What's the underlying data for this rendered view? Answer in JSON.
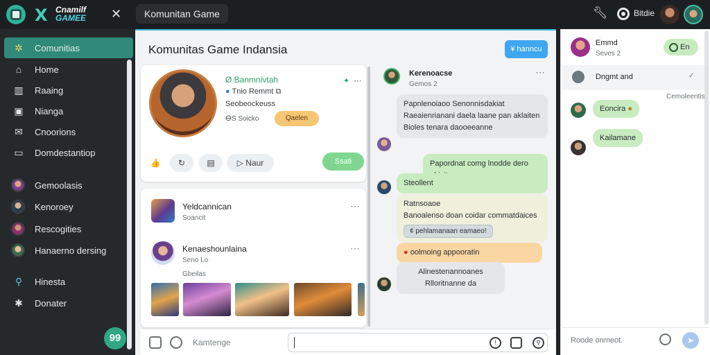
{
  "window": {
    "logo_line1": "Cnamilf",
    "logo_line2": "GAMEE",
    "close_glyph": "✕",
    "tab_title": "Komunitan Game",
    "user_label": "Bitdie"
  },
  "sidebar": {
    "items": [
      {
        "label": "Comunitias",
        "icon": "grid-icon",
        "glyph": "✲"
      },
      {
        "label": "Home",
        "icon": "home-icon",
        "glyph": "⌂"
      },
      {
        "label": "Raaing",
        "icon": "chart-icon",
        "glyph": "▥"
      },
      {
        "label": "Nianga",
        "icon": "image-icon",
        "glyph": "▣"
      },
      {
        "label": "Cnoorions",
        "icon": "mail-icon",
        "glyph": "✉"
      },
      {
        "label": "Domdestantiop",
        "icon": "desktop-icon",
        "glyph": "▭"
      }
    ],
    "communities": [
      {
        "label": "Gemoolasis"
      },
      {
        "label": "Kenoroey"
      },
      {
        "label": "Rescogities"
      },
      {
        "label": "Hanaerno dersing"
      }
    ],
    "footer": [
      {
        "label": "Hinesta",
        "icon": "search-icon",
        "glyph": "⚲"
      },
      {
        "label": "Donater",
        "icon": "gear-icon",
        "glyph": "✱"
      }
    ],
    "fab_glyph": "99"
  },
  "main": {
    "title": "Komunitas Game Indansia",
    "top_button": "¥ hanncu",
    "profile": {
      "name": "Ø Banmnivtah",
      "sub": "Tnio Remmt",
      "line": "Seobeockeuss",
      "stat": "ⴱS Soicko",
      "badge": "Qaelen",
      "actions": [
        "👍",
        "↻",
        "▤",
        "Naur"
      ],
      "follow": "Ssati"
    },
    "list": [
      {
        "title": "Yeldcannican",
        "sub": "Soancit"
      },
      {
        "title": "Kenaeshounlaina",
        "sub": "Seno Lo"
      }
    ],
    "gallery_label": "Gbeilas",
    "input_placeholder": "Kamtenge"
  },
  "chat": {
    "header_name": "Kerenoacse",
    "header_sub": "Gemos  2",
    "messages": [
      {
        "lines": [
          "Papnlenoiaoo Senonnisdakiat",
          "Raeaienrianani daela laane pan aklaiten",
          "Bioles tenara daooeeanne"
        ],
        "style": "gray"
      },
      {
        "lines": [
          "Papordnat comg lnodde dero obicite"
        ],
        "style": "green"
      },
      {
        "lines": [
          "Steollent"
        ],
        "style": "green"
      },
      {
        "lines": [
          "Ratnsoaoe",
          "Banoalenso doan coidar commatdaices"
        ],
        "pill": "¢ pehlamanaan eamaeo!",
        "style": "cream"
      },
      {
        "lines": [
          "oolmoing appooratin"
        ],
        "style": "orange"
      },
      {
        "lines": [
          "Alinestenannoanes",
          "Rlloritnanne da"
        ],
        "style": "gray"
      }
    ]
  },
  "right": {
    "name": "Emmd",
    "sub": "Seves 2",
    "online": "En",
    "row_label": "Dngmt and",
    "row_check": "✓",
    "meta": "Cemoleentis",
    "bubbles": [
      "Eoncira",
      "Kailamane"
    ],
    "input_placeholder": "Roode onmeot."
  }
}
